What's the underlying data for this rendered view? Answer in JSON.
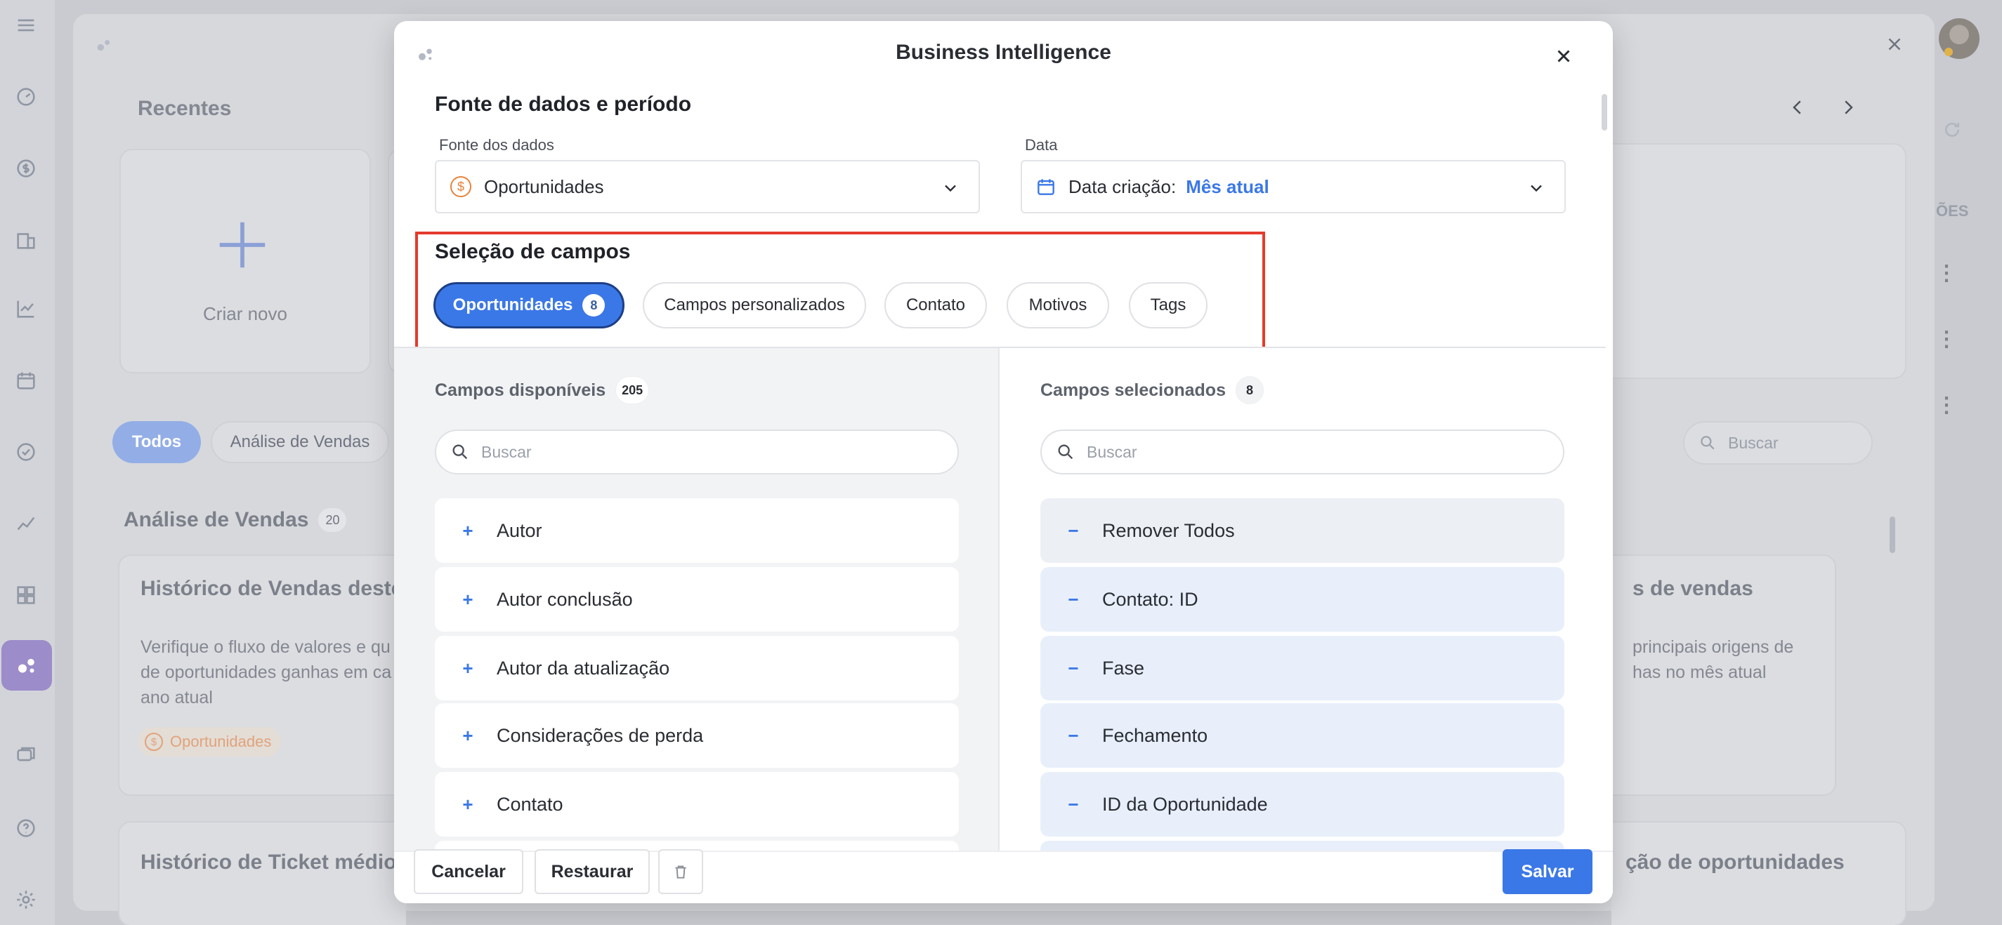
{
  "background": {
    "recent_title": "Recentes",
    "create_new_label": "Criar novo",
    "filters": [
      "Todos",
      "Análise de Vendas"
    ],
    "section_title": "Análise de Vendas",
    "section_count": "20",
    "search_placeholder": "Buscar",
    "right_header_partial": "ÕES",
    "cards": [
      {
        "title": "Histórico de Vendas deste a",
        "desc_line1": "Verifique o fluxo de valores e qu",
        "desc_line2": "de oportunidades ganhas em ca",
        "desc_line3": "ano atual",
        "tag": "Oportunidades"
      },
      {
        "title": "s de vendas",
        "desc_line1": "principais origens de",
        "desc_line2": "has no mês atual"
      }
    ],
    "bottom_left_title": "Histórico de Ticket médio de",
    "bottom_right_title": "ção de oportunidades"
  },
  "modal": {
    "title": "Business Intelligence",
    "source_section_title": "Fonte de dados e período",
    "data_source_label": "Fonte dos dados",
    "data_source_value": "Oportunidades",
    "date_label": "Data",
    "date_prefix": "Data criação:",
    "date_value": "Mês atual",
    "fields_section_title": "Seleção de campos",
    "tabs": [
      {
        "label": "Oportunidades",
        "badge": "8"
      },
      {
        "label": "Campos personalizados"
      },
      {
        "label": "Contato"
      },
      {
        "label": "Motivos"
      },
      {
        "label": "Tags"
      }
    ],
    "available": {
      "title": "Campos disponíveis",
      "count": "205",
      "search_placeholder": "Buscar",
      "items": [
        "Autor",
        "Autor conclusão",
        "Autor da atualização",
        "Considerações de perda",
        "Contato"
      ]
    },
    "selected": {
      "title": "Campos selecionados",
      "count": "8",
      "search_placeholder": "Buscar",
      "items": [
        "Remover Todos",
        "Contato: ID",
        "Fase",
        "Fechamento",
        "ID da Oportunidade"
      ]
    },
    "footer": {
      "cancel": "Cancelar",
      "restore": "Restaurar",
      "save": "Salvar"
    }
  },
  "colors": {
    "accent": "#3b78e7",
    "highlight": "#e53a2d",
    "orange": "#e8833a"
  }
}
